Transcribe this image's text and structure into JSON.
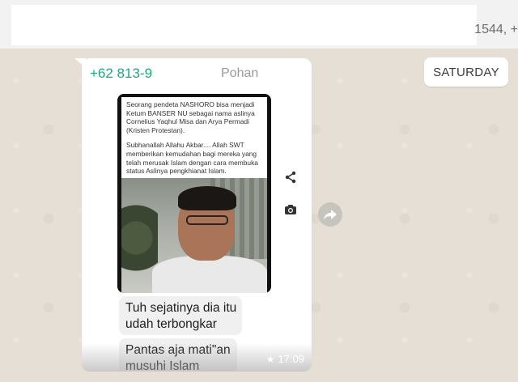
{
  "top_bar": {
    "number_text": "1544, +"
  },
  "date_chip": {
    "label": "SATURDAY"
  },
  "message": {
    "sender_number": "+62 813-9",
    "sender_name": "Pohan",
    "image_text": {
      "paragraph1": "Seorang pendeta NASHORO bisa menjadi Ketum BANSER NU sebagai nama aslinya Cornelius Yaqhul Misa dan Arya Permadi (Kristen Protestan).",
      "paragraph2": "Subhanallah Allahu Akbar.... Allah SWT memberikan kemudahan bagi mereka yang telah merusak Islam dengan cara membuka status Aslinya pengkhianat Islam."
    },
    "text1_line1": "Tuh sejatinya dia itu",
    "text1_line2": "udah terbongkar",
    "text2_line1": "Pantas aja mati\"an",
    "text2_line2": "musuhi  Islam",
    "time": "17:09"
  },
  "icons": {
    "share": "share-icon",
    "camera": "camera-icon",
    "forward": "forward-icon",
    "star": "star-icon"
  },
  "colors": {
    "sender": "#1ea87f",
    "background": "#e6dfd6",
    "bubble": "#ffffff"
  }
}
